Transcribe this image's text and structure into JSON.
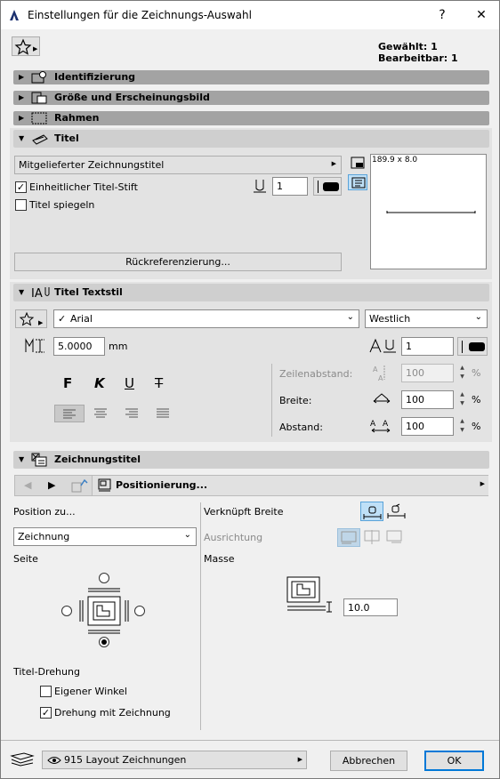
{
  "window": {
    "title": "Einstellungen für die Zeichnungs-Auswahl",
    "help": "?",
    "close": "✕"
  },
  "header": {
    "selection_status": "Gewählt: 1 Bearbeitbar: 1"
  },
  "sections": {
    "identifizierung": "Identifizierung",
    "groesse": "Größe und Erscheinungsbild",
    "rahmen": "Rahmen",
    "titel": "Titel",
    "titel_textstil": "Titel Textstil",
    "zeichnungstitel": "Zeichnungstitel"
  },
  "titel": {
    "title_type": "Mitgelieferter Zeichnungstitel",
    "uniform_pen_label": "Einheitlicher Titel-Stift",
    "uniform_pen_checked": "✓",
    "pen_value": "1",
    "mirror_label": "Titel spiegeln",
    "preview_size": "189.9 x 8.0",
    "crossref_button": "Rückreferenzierung..."
  },
  "textstil": {
    "font": "Arial",
    "font_check": "✓",
    "script": "Westlich",
    "size": "5.0000",
    "size_unit": "mm",
    "pen": "1",
    "bold": "F",
    "italic": "K",
    "underline": "U",
    "strike": "T",
    "line_spacing_label": "Zeilenabstand:",
    "line_spacing": "100",
    "width_label": "Breite:",
    "width": "100",
    "spacing_label": "Abstand:",
    "spacing": "100",
    "percent": "%"
  },
  "zeichnungstitel": {
    "tool_dropdown": "Positionierung...",
    "position_label": "Position zu...",
    "position_value": "Zeichnung",
    "side_label": "Seite",
    "rotation_label": "Titel-Drehung",
    "own_angle_label": "Eigener Winkel",
    "rotate_with_label": "Drehung mit Zeichnung",
    "rotate_with_checked": "✓",
    "linked_width_label": "Verknüpft Breite",
    "alignment_label": "Ausrichtung",
    "mass_label": "Masse",
    "offset": "10.0"
  },
  "footer": {
    "layer": "915 Layout Zeichnungen",
    "cancel": "Abbrechen",
    "ok": "OK"
  }
}
